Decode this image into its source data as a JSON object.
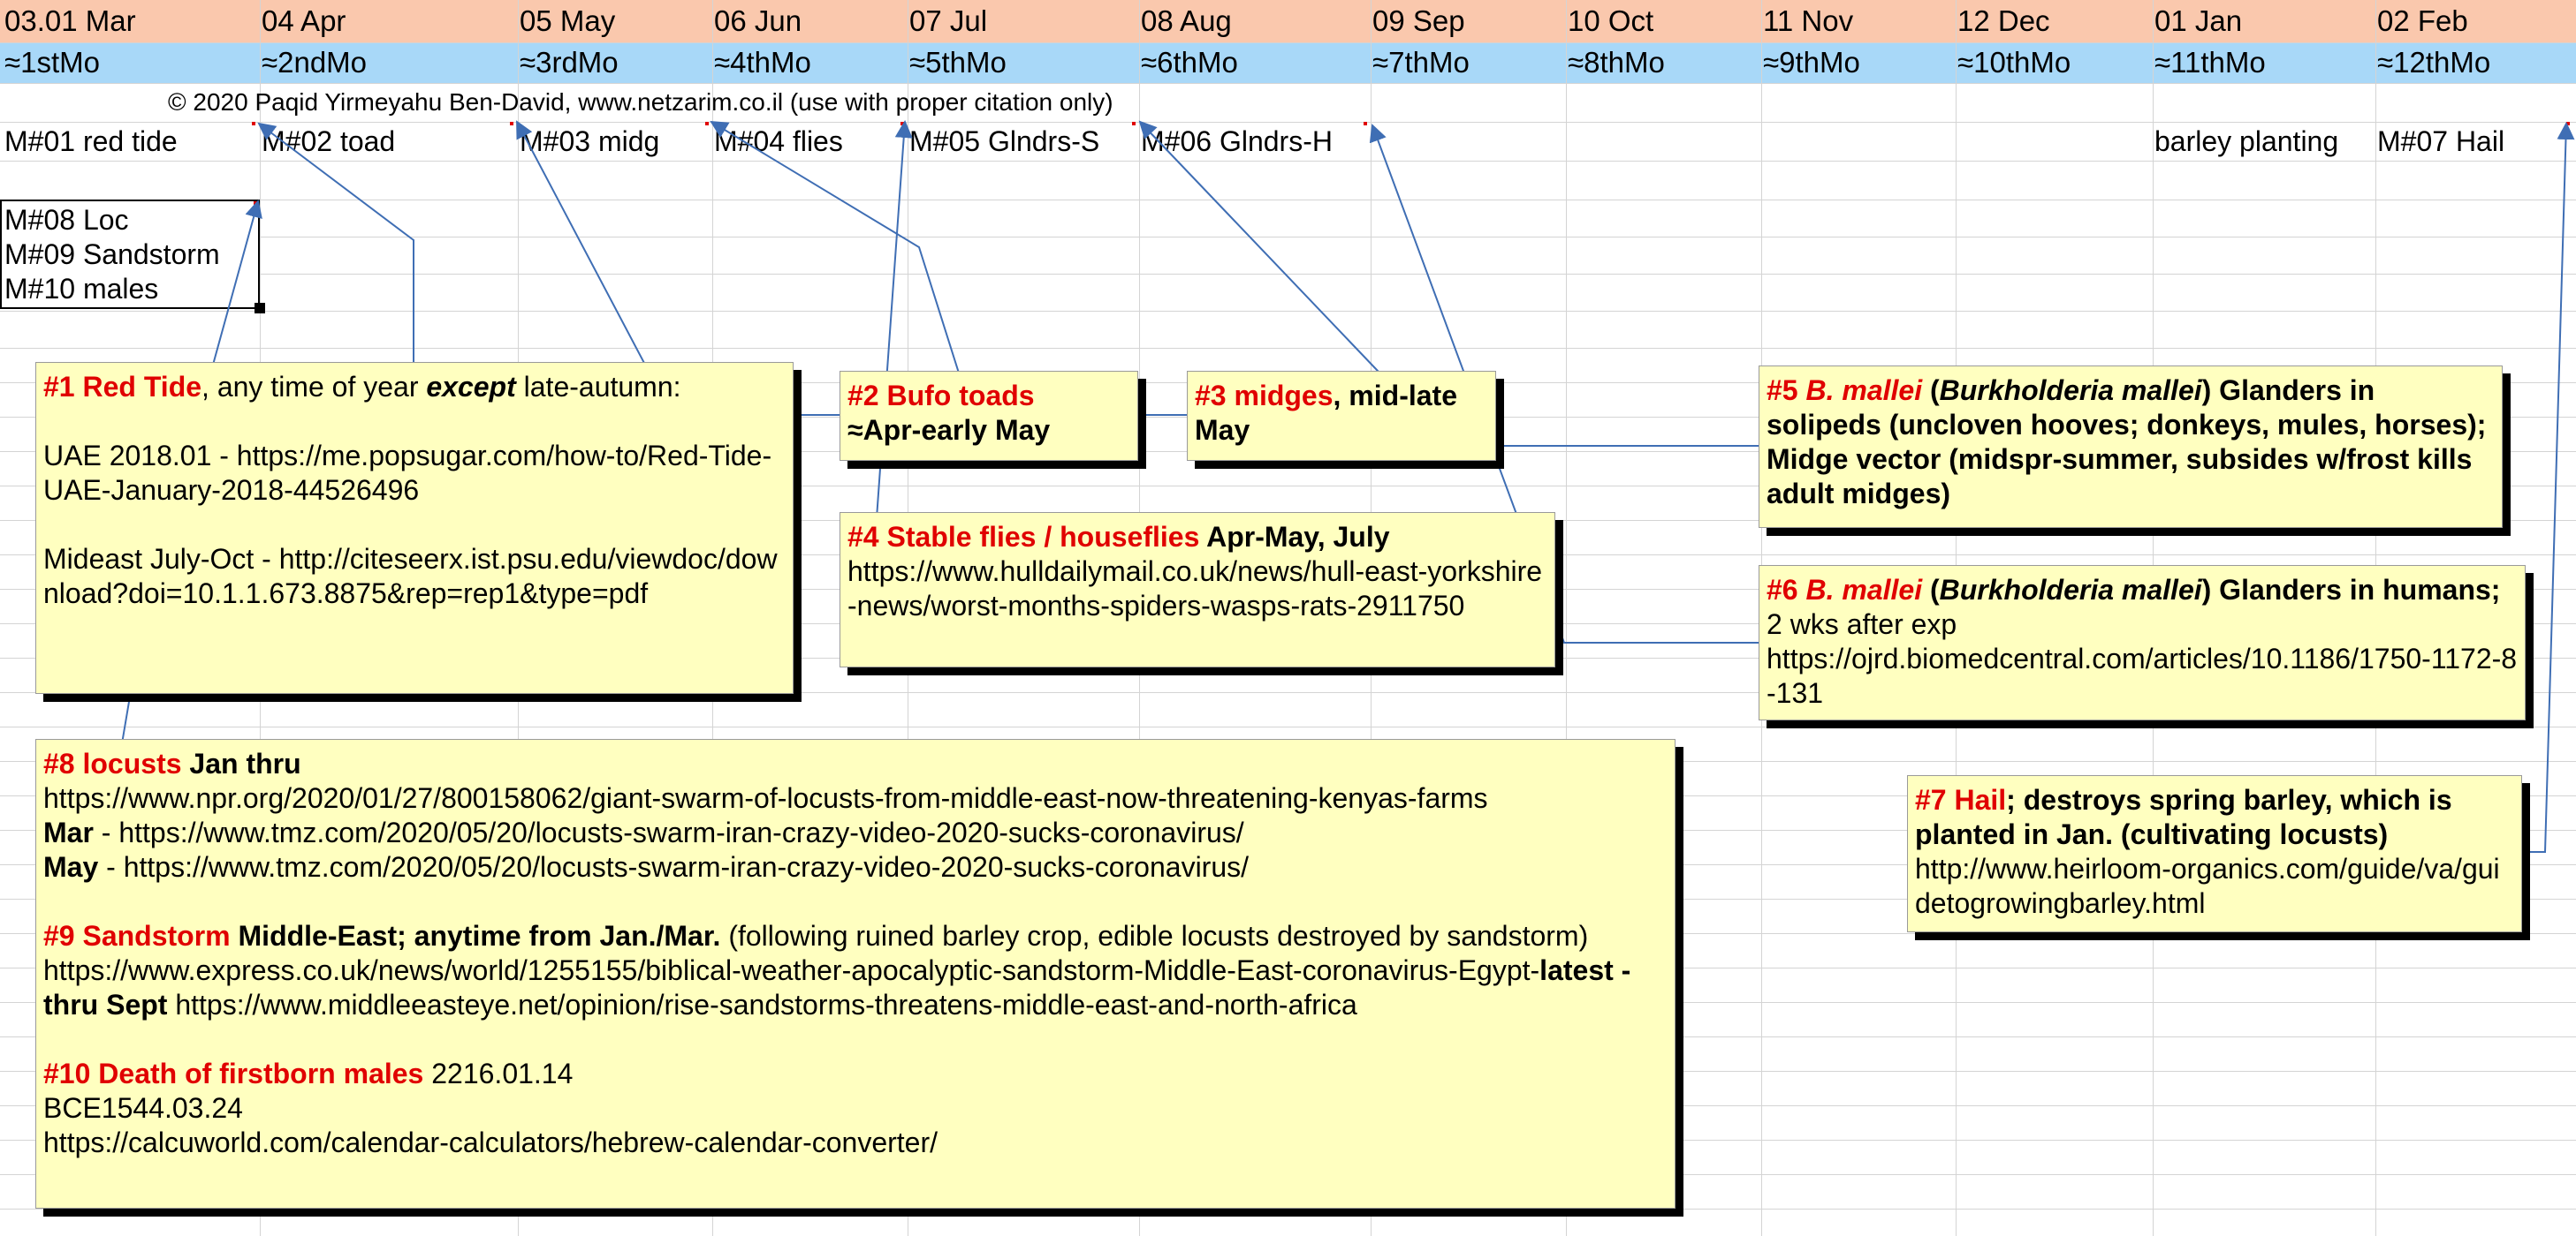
{
  "months": [
    {
      "date": "03.01 Mar",
      "label": "≈1stMo"
    },
    {
      "date": "04 Apr",
      "label": "≈2ndMo"
    },
    {
      "date": "05 May",
      "label": "≈3rdMo"
    },
    {
      "date": "06 Jun",
      "label": "≈4thMo"
    },
    {
      "date": "07 Jul",
      "label": "≈5thMo"
    },
    {
      "date": "08 Aug",
      "label": "≈6thMo"
    },
    {
      "date": "09 Sep",
      "label": "≈7thMo"
    },
    {
      "date": "10 Oct",
      "label": "≈8thMo"
    },
    {
      "date": "11 Nov",
      "label": "≈9thMo"
    },
    {
      "date": "12 Dec",
      "label": "≈10thMo"
    },
    {
      "date": "01 Jan",
      "label": "≈11thMo"
    },
    {
      "date": "02 Feb",
      "label": "≈12thMo"
    }
  ],
  "colors": {
    "header_date_bg": "#fac8ad",
    "header_month_bg": "#a8d8f8",
    "note_bg": "#ffffc0",
    "accent_red": "#e00000",
    "arrow": "#3f6eb4"
  },
  "copyright": "© 2020 Paqid Yirmeyahu Ben-David, www.netzarim.co.il (use with proper citation only)",
  "row_m": {
    "m01": "M#01 red tide",
    "m02": "M#02 toad",
    "m03": "M#03 midg",
    "m04": "M#04 flies",
    "m05": "M#05 Glndrs-S",
    "m06": "M#06 Glndrs-H",
    "barley": "barley planting",
    "m07": "M#07 Hail"
  },
  "selected_cell": {
    "line1": "M#08 Loc",
    "line2": "M#09 Sandstorm",
    "line3": "M#10 males"
  },
  "notes": {
    "n1": {
      "title": "#1 Red Tide",
      "t1": ", any time of year ",
      "t2": "except",
      "t3": " late-autumn:",
      "p2": "UAE 2018.01 - https://me.popsugar.com/how-to/Red-Tide-UAE-January-2018-44526496",
      "p3": "Mideast July-Oct - http://citeseerx.ist.psu.edu/viewdoc/download?doi=10.1.1.673.8875&rep=rep1&type=pdf"
    },
    "n2": {
      "title": "#2 Bufo toads",
      "body": "≈Apr-early May"
    },
    "n3": {
      "title": "#3 midges",
      "body": ", mid-late May"
    },
    "n4": {
      "title": "#4 Stable flies / houseflies",
      "t1": " Apr-May, July",
      "url": "https://www.hulldailymail.co.uk/news/hull-east-yorkshire-news/worst-months-spiders-wasps-rats-2911750"
    },
    "n5": {
      "title": "#5 ",
      "italic1": "B. mallei",
      "t1": " (",
      "italic2": "Burkholderia mallei",
      "t2": ") Glanders  in solipeds (uncloven hooves; donkeys, mules, horses); Midge vector (midspr-summer, subsides w/frost kills adult midges)"
    },
    "n6": {
      "title": "#6 ",
      "italic1": "B. mallei",
      "t1": " (",
      "italic2": "Burkholderia mallei",
      "t2": ") Glanders  in humans;",
      "t3": " 2 wks after exp",
      "url": "https://ojrd.biomedcentral.com/articles/10.1186/1750-1172-8-131"
    },
    "n7": {
      "title": "#7 Hail",
      "t1": "; destroys spring barley, which is planted in Jan. (cultivating locusts)",
      "url": "http://www.heirloom-organics.com/guide/va/guidetogrowingbarley.html"
    },
    "n8": {
      "title": "#8 locusts",
      "t1": " Jan thru",
      "l2": "https://www.npr.org/2020/01/27/800158062/giant-swarm-of-locusts-from-middle-east-now-threatening-kenyas-farms",
      "l3b": "Mar",
      "l3": " - https://www.tmz.com/2020/05/20/locusts-swarm-iran-crazy-video-2020-sucks-coronavirus/",
      "l4b": "May",
      "l4": " - https://www.tmz.com/2020/05/20/locusts-swarm-iran-crazy-video-2020-sucks-coronavirus/",
      "s_title": "#9 Sandstorm",
      "s_b1": " Middle-East; anytime from Jan./Mar.",
      "s_t1": " (following ruined barley crop, edible locusts destroyed by sandstorm) https://www.express.co.uk/news/world/1255155/biblical-weather-apocalyptic-sandstorm-Middle-East-coronavirus-Egypt-",
      "s_b2": "latest - thru Sept",
      "s_t2": " https://www.middleeasteye.net/opinion/rise-sandstorms-threatens-middle-east-and-north-africa",
      "d_title": "#10 Death of firstborn males",
      "d_t1": " 2216.01.14",
      "d_l2": "BCE1544.03.24",
      "d_l3": "https://calcuworld.com/calendar-calculators/hebrew-calendar-converter/"
    }
  }
}
